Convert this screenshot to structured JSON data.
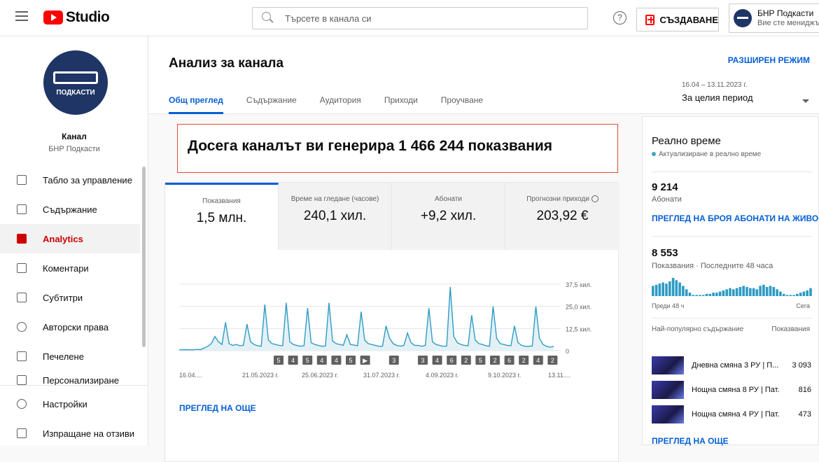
{
  "header": {
    "logo_text": "Studio",
    "search_placeholder": "Търсете в канала си",
    "help": "?",
    "create_label": "СЪЗДАВАНЕ",
    "account_name": "БНР Подкасти",
    "account_sub": "Вие сте мениджър"
  },
  "sidebar": {
    "channel_logo_text": "ПОДКАСТИ",
    "channel_label": "Канал",
    "channel_name": "БНР Подкасти",
    "items": [
      {
        "label": "Табло за управление",
        "icon": "dashboard-icon"
      },
      {
        "label": "Съдържание",
        "icon": "content-icon"
      },
      {
        "label": "Analytics",
        "icon": "analytics-icon",
        "active": true
      },
      {
        "label": "Коментари",
        "icon": "comments-icon"
      },
      {
        "label": "Субтитри",
        "icon": "subtitles-icon"
      },
      {
        "label": "Авторски права",
        "icon": "copyright-icon"
      },
      {
        "label": "Печелене",
        "icon": "monetization-icon"
      },
      {
        "label": "Персонализиране",
        "icon": "customization-icon"
      }
    ],
    "bottom_items": [
      {
        "label": "Настройки",
        "icon": "settings-icon"
      },
      {
        "label": "Изпращане на отзиви",
        "icon": "feedback-icon"
      }
    ]
  },
  "main": {
    "title": "Анализ за канала",
    "advanced_mode": "РАЗШИРЕН РЕЖИМ",
    "date_range": "16.04 – 13.11.2023 г.",
    "period": "За целия период",
    "tabs": [
      "Общ преглед",
      "Съдържание",
      "Аудитория",
      "Приходи",
      "Проучване"
    ],
    "hero": "Досега каналът ви генерира 1 466 244 показвания",
    "metrics": [
      {
        "label": "Показвания",
        "value": "1,5 млн."
      },
      {
        "label": "Време на гледане (часове)",
        "value": "240,1 хил."
      },
      {
        "label": "Абонати",
        "value": "+9,2 хил."
      },
      {
        "label": "Прогнозни приходи",
        "value": "203,92 €"
      }
    ],
    "see_more": "ПРЕГЛЕД НА ОЩЕ"
  },
  "chart_data": {
    "type": "area",
    "y_ticks": [
      "37,5 хил.",
      "25,0 хил.",
      "12,5 хил.",
      "0"
    ],
    "ylim": [
      0,
      37500
    ],
    "x_ticks": [
      "16.04....",
      "21.05.2023 г.",
      "25.06.2023 г.",
      "31.07.2023 г.",
      "4.09.2023 г.",
      "9.10.2023 г.",
      "13.11...."
    ],
    "markers": [
      "5",
      "4",
      "5",
      "4",
      "4",
      "5",
      "▶",
      "3",
      "3",
      "4",
      "6",
      "2",
      "5",
      "2",
      "6",
      "2",
      "4",
      "2"
    ],
    "values": [
      500,
      500,
      600,
      500,
      500,
      700,
      600,
      1500,
      2500,
      4000,
      8000,
      5000,
      3500,
      16000,
      4000,
      3000,
      3500,
      2800,
      3000,
      15000,
      5000,
      3500,
      2800,
      2500,
      26000,
      6000,
      4000,
      3500,
      3000,
      2800,
      27000,
      5000,
      3500,
      3000,
      2500,
      2800,
      24000,
      4500,
      3500,
      3000,
      2500,
      2700,
      27000,
      5500,
      4000,
      3500,
      3000,
      9000,
      3500,
      3200,
      2800,
      22000,
      6000,
      4000,
      3500,
      3000,
      2500,
      2500,
      14000,
      7000,
      4000,
      3000,
      2600,
      3000,
      10000,
      4500,
      3000,
      3000,
      2500,
      3000,
      24000,
      5000,
      3500,
      3000,
      2500,
      2600,
      36000,
      8000,
      4500,
      3500,
      3000,
      2800,
      20000,
      6000,
      4000,
      3500,
      2800,
      2500,
      25000,
      7000,
      4000,
      3500,
      3000,
      2800,
      14000,
      4500,
      3000,
      2500,
      2500,
      2700,
      25000,
      7000,
      3500,
      2500,
      2000,
      2500
    ]
  },
  "realtime": {
    "title": "Реално време",
    "live": "Актуализиране в реално време",
    "subs_value": "9 214",
    "subs_label": "Абонати",
    "subs_link": "ПРЕГЛЕД НА БРОЯ АБОНАТИ НА ЖИВО",
    "views_value": "8 553",
    "views_label": "Показвания · Последните 48 часа",
    "mini_left": "Преди 48 ч",
    "mini_right": "Сега",
    "mini_values": [
      9,
      10,
      11,
      12,
      11,
      13,
      16,
      14,
      12,
      9,
      6,
      3,
      1,
      1,
      1,
      1,
      2,
      2,
      3,
      3,
      4,
      5,
      6,
      7,
      6,
      7,
      8,
      9,
      8,
      7,
      7,
      6,
      9,
      10,
      8,
      9,
      8,
      6,
      4,
      2,
      1,
      1,
      1,
      2,
      3,
      4,
      5,
      7
    ],
    "top_header": "Най-популярно съдържание",
    "top_header_right": "Показвания",
    "top": [
      {
        "title": "Дневна смяна 3 РУ | П...",
        "value": "3 093"
      },
      {
        "title": "Нощна смяна 8 РУ | Пат...",
        "value": "816"
      },
      {
        "title": "Нощна смяна 4 РУ | Пат...",
        "value": "473"
      }
    ],
    "see_more": "ПРЕГЛЕД НА ОЩЕ"
  }
}
